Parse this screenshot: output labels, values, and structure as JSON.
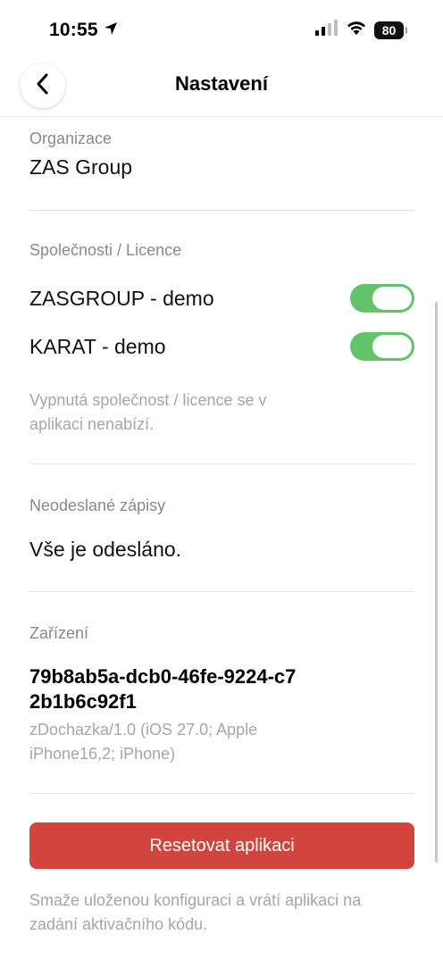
{
  "status_bar": {
    "time": "10:55",
    "battery": "80",
    "icons": [
      "location-arrow-icon",
      "cellular-signal-icon",
      "wifi-icon",
      "battery-icon"
    ]
  },
  "nav": {
    "title": "Nastavení",
    "back_icon": "chevron-left-icon"
  },
  "organization": {
    "label": "Organizace",
    "value": "ZAS Group"
  },
  "companies": {
    "label": "Společnosti / Licence",
    "items": [
      {
        "name": "ZASGROUP - demo",
        "enabled": true
      },
      {
        "name": "KARAT - demo",
        "enabled": true
      }
    ],
    "note": "Vypnutá společnost / licence se v aplikaci nenabízí."
  },
  "unsent": {
    "label": "Neodeslané zápisy",
    "value": "Vše je odesláno."
  },
  "device": {
    "label": "Zařízení",
    "id": "79b8ab5a-dcb0-46fe-9224-c72b1b6c92f1",
    "user_agent": "zDochazka/1.0 (iOS 27.0; Apple iPhone16,2; iPhone)"
  },
  "reset": {
    "button_label": "Resetovat aplikaci",
    "note": "Smaže uloženou konfiguraci a vrátí aplikaci na zadání aktivačního kódu."
  },
  "colors": {
    "toggle_on": "#62c36a",
    "reset_button": "#d2453f",
    "muted_text": "#a6a6a6"
  }
}
